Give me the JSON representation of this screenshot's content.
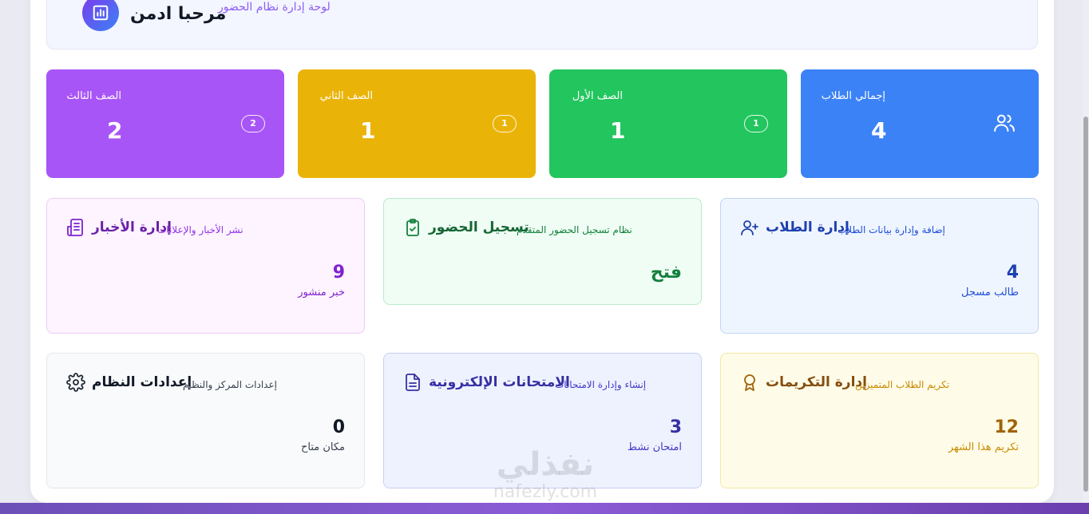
{
  "welcome": {
    "title": "مرحبا ادمن",
    "subtitle": "لوحة إدارة نظام الحضور",
    "icon": "chart-bar-icon"
  },
  "stats": [
    {
      "label": "إجمالي الطلاب",
      "value": "4",
      "icon": "users-icon",
      "color": "#3b82f6"
    },
    {
      "label": "الصف الأول",
      "value": "1",
      "badge": "1",
      "color": "#22c55e"
    },
    {
      "label": "الصف الثاني",
      "value": "1",
      "badge": "1",
      "color": "#eab308"
    },
    {
      "label": "الصف الثالث",
      "value": "2",
      "badge": "2",
      "color": "#a855f7"
    }
  ],
  "features": [
    {
      "title": "إدارة الطلاب",
      "subtitle": "إضافة وإدارة بيانات الطلاب",
      "value": "4",
      "caption": "طالب مسجل",
      "icon": "user-plus-icon",
      "color": "#1e40af"
    },
    {
      "title": "تسجيل الحضور",
      "subtitle": "نظام تسجيل الحضور المتقدم",
      "value": "فتح",
      "icon": "clipboard-check-icon",
      "color": "#15803d"
    },
    {
      "title": "إدارة الأخبار",
      "subtitle": "نشر الأخبار والإعلانات",
      "value": "9",
      "caption": "خبر منشور",
      "icon": "newspaper-icon",
      "color": "#7e22ce"
    },
    {
      "title": "إدارة التكريمات",
      "subtitle": "تكريم الطلاب المتميزين",
      "value": "12",
      "caption": "تكريم هذا الشهر",
      "icon": "award-icon",
      "color": "#a16207"
    },
    {
      "title": "الامتحانات الإلكترونية",
      "subtitle": "إنشاء وإدارة الامتحانات",
      "value": "3",
      "caption": "امتحان نشط",
      "icon": "file-text-icon",
      "color": "#3730a3"
    },
    {
      "title": "إعدادات النظام",
      "subtitle": "إعدادات المركز والنظام",
      "value": "0",
      "caption": "مكان متاح",
      "icon": "gear-icon",
      "color": "#1f2937"
    }
  ],
  "watermark": {
    "arabic": "نفذلي",
    "latin": "nafezly.com"
  }
}
